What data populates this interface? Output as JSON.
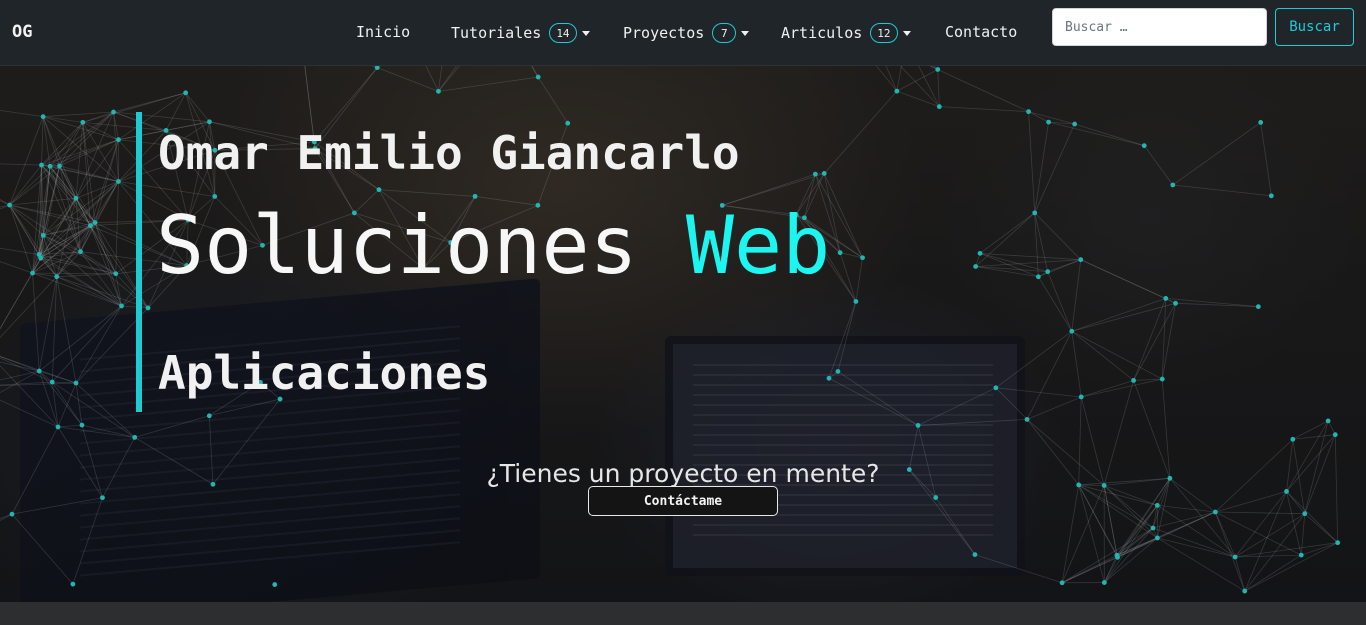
{
  "brand": "OG",
  "nav": {
    "inicio": "Inicio",
    "tutoriales": {
      "label": "Tutoriales",
      "count": "14"
    },
    "proyectos": {
      "label": "Proyectos",
      "count": "7"
    },
    "articulos": {
      "label": "Articulos",
      "count": "12"
    },
    "contacto": "Contacto"
  },
  "search": {
    "placeholder": "Buscar …",
    "value": "",
    "button_label": "Buscar"
  },
  "hero": {
    "name": "Omar Emilio Giancarlo",
    "title_main": "Soluciones",
    "title_accent": "Web",
    "subtitle": "Aplicaciones",
    "question": "¿Tienes un proyecto en mente?",
    "cta_label": "Contáctame"
  },
  "colors": {
    "accent": "#1ecbd2",
    "accent_text": "#1cf5f0",
    "navbar_bg": "#1f2529",
    "node": "#1fb7b3"
  },
  "icons": [
    "dropdown-caret-icon"
  ]
}
